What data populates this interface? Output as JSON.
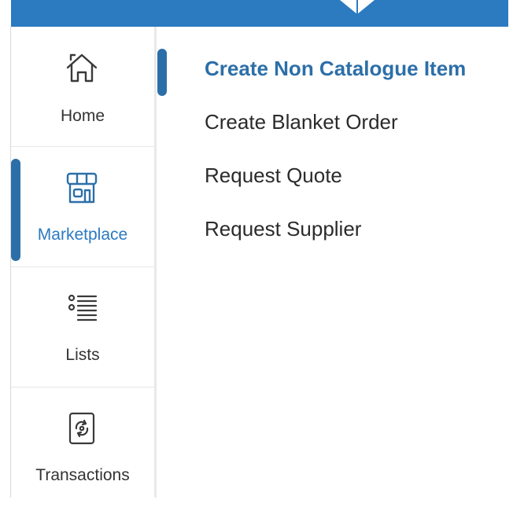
{
  "colors": {
    "header": "#2c7ac0",
    "accent": "#2c6fa8",
    "text": "#2b2b2b"
  },
  "sidebar": {
    "items": [
      {
        "label": "Home",
        "icon": "home-icon"
      },
      {
        "label": "Marketplace",
        "icon": "storefront-icon",
        "active": true
      },
      {
        "label": "Lists",
        "icon": "list-icon"
      },
      {
        "label": "Transactions",
        "icon": "transactions-icon"
      }
    ]
  },
  "submenu": {
    "items": [
      {
        "label": "Create Non Catalogue Item",
        "active": true
      },
      {
        "label": "Create Blanket Order"
      },
      {
        "label": "Request Quote"
      },
      {
        "label": "Request Supplier"
      }
    ]
  }
}
